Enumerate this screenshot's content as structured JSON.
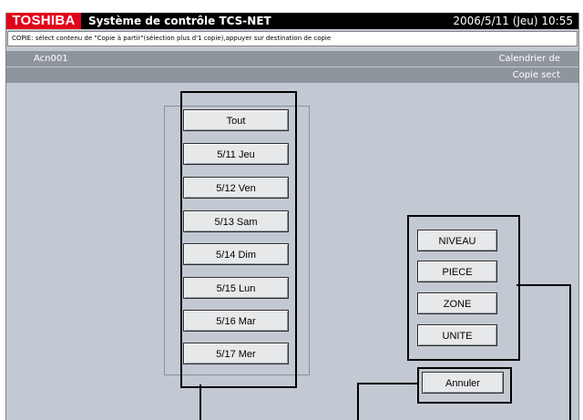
{
  "brand": {
    "logo": "TOSHIBA",
    "app_title": "Système de contrôle TCS-NET",
    "datetime": "2006/5/11 (Jeu)  10:55"
  },
  "instruction": "COPIE: sélect contenu de \"Copie à partir\"(sélection plus d'1 copie),appuyer sur destination de copie",
  "header": {
    "unit_name": "Acn001",
    "screen_name": "Calendrier de",
    "mode": "Copie sect"
  },
  "dates": {
    "all": "Tout",
    "items": [
      "5/11 Jeu",
      "5/12 Ven",
      "5/13 Sam",
      "5/14 Dim",
      "5/15 Lun",
      "5/16 Mar",
      "5/17 Mer"
    ]
  },
  "levels": [
    "NIVEAU",
    "PIECE",
    "ZONE",
    "UNITE"
  ],
  "cancel_label": "Annuler",
  "colors": {
    "panel": "#c3c9d2",
    "band": "#8f959d",
    "brand_red": "#e3001b",
    "title_bg": "#000000"
  }
}
